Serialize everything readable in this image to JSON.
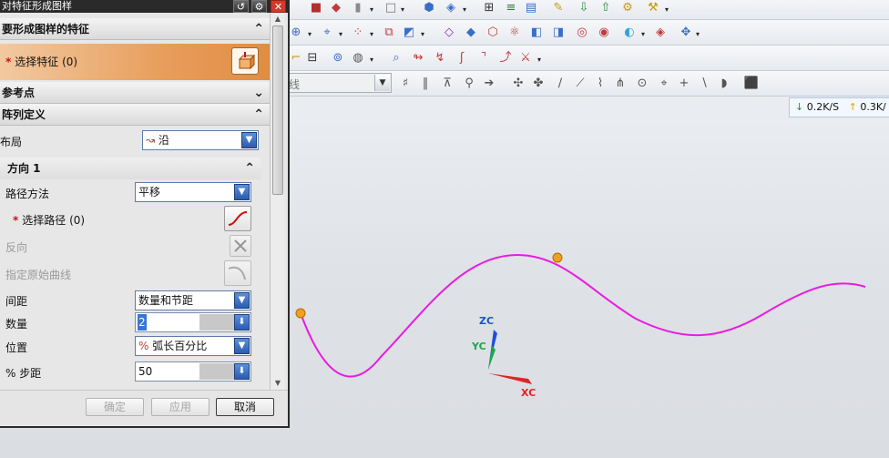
{
  "dialog": {
    "title": "对特征形成图样",
    "sections": {
      "features_to_pattern": "要形成图样的特征",
      "reference_point": "参考点",
      "pattern_definition": "阵列定义"
    },
    "select_feature": {
      "label": "选择特征 (0)",
      "required_marker": "*"
    },
    "layout": {
      "label": "布局",
      "value": "沿"
    },
    "direction": {
      "title": "方向 1",
      "path_method": {
        "label": "路径方法",
        "value": "平移"
      },
      "select_path": {
        "label": "选择路径 (0)",
        "required_marker": "*"
      },
      "reverse": {
        "label": "反向"
      },
      "original_curve": {
        "label": "指定原始曲线"
      },
      "spacing": {
        "label": "间距",
        "value": "数量和节距"
      },
      "count": {
        "label": "数量",
        "value": "2"
      },
      "position": {
        "label": "位置",
        "value": "弧长百分比",
        "prefix": "%"
      },
      "pitch_percent": {
        "label": "% 步距",
        "value": "50"
      }
    },
    "footer": {
      "ok": "确定",
      "apply": "应用",
      "cancel": "取消"
    }
  },
  "toolbar": {
    "selection_filter": {
      "value": "线"
    }
  },
  "status": {
    "download_rate": "0.2K/S",
    "upload_rate": "0.3K/"
  },
  "viewport": {
    "axes": {
      "z": "ZC",
      "y": "YC",
      "x": "XC"
    },
    "colors": {
      "curve": "#e81ce0",
      "point": "#f0a020",
      "x_axis": "#e02424",
      "y_axis": "#1aa84a",
      "z_axis": "#1f4fd8"
    }
  }
}
